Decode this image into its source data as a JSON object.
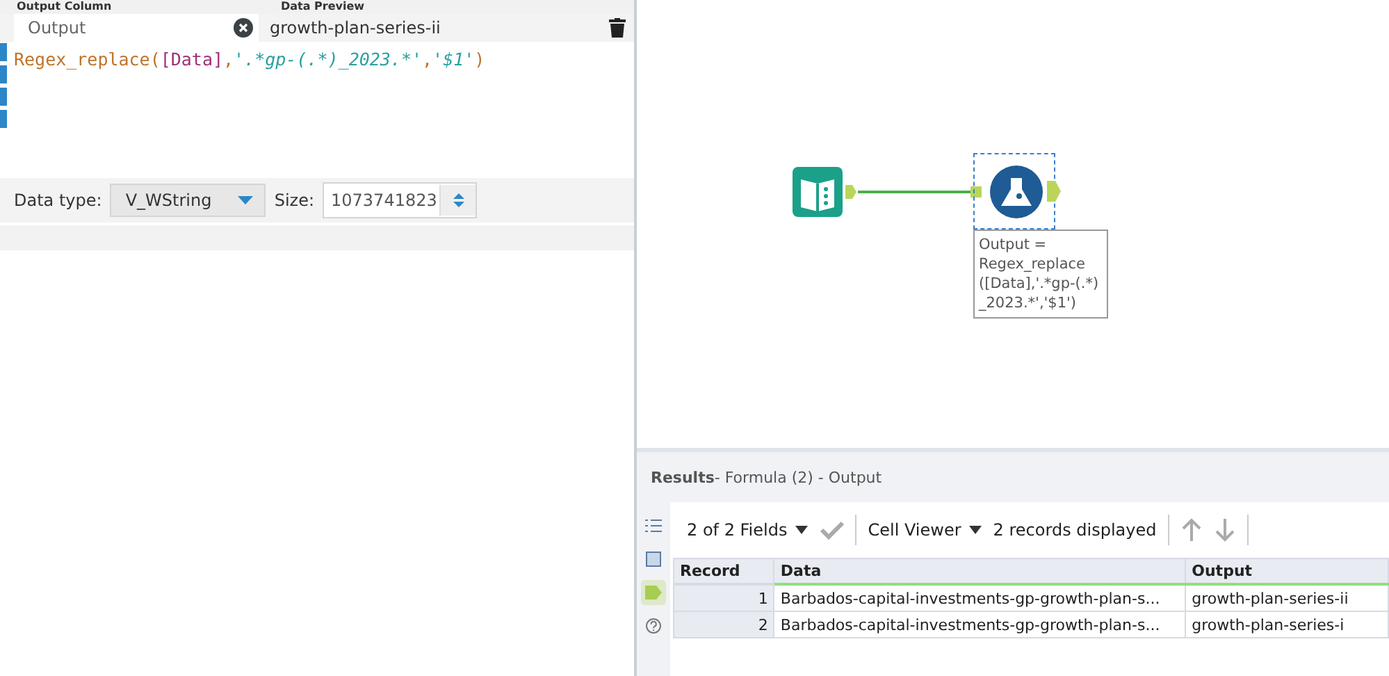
{
  "config": {
    "headers": [
      "Output Column",
      "Data Preview"
    ],
    "output_field": {
      "value": "Output"
    },
    "preview": "growth-plan-series-ii",
    "expression": [
      {
        "kind": "function",
        "text": "Regex_replace("
      },
      {
        "kind": "field",
        "text": "[Data]"
      },
      {
        "kind": "function",
        "text": ","
      },
      {
        "kind": "string",
        "text": "'.*gp-(.*)_2023.*'"
      },
      {
        "kind": "function",
        "text": ","
      },
      {
        "kind": "string",
        "text": "'$1'"
      },
      {
        "kind": "function",
        "text": ")"
      }
    ],
    "data_type": {
      "label": "Data type:",
      "value": "V_WString"
    },
    "size": {
      "label": "Size:",
      "value": "1073741823"
    }
  },
  "canvas": {
    "annotation": "Output = Regex_replace ([Data],'.*gp-(.*) _2023.*','$1')",
    "formula_selected": true
  },
  "results": {
    "title": "Results",
    "subtitle": " - Formula (2) - Output",
    "toolbar": {
      "fields": "2 of 2 Fields",
      "viewer": "Cell Viewer",
      "count": "2 records displayed"
    },
    "side_tools": [
      {
        "kind": "list",
        "selected": false
      },
      {
        "kind": "table",
        "selected": false
      },
      {
        "kind": "tag",
        "selected": true
      },
      {
        "kind": "help",
        "selected": false
      }
    ],
    "columns": [
      "Record",
      "Data",
      "Output"
    ],
    "rows": [
      [
        "1",
        "Barbados-capital-investments-gp-growth-plan-s...",
        "growth-plan-series-ii"
      ],
      [
        "2",
        "Barbados-capital-investments-gp-growth-plan-s...",
        "growth-plan-series-i"
      ]
    ]
  }
}
